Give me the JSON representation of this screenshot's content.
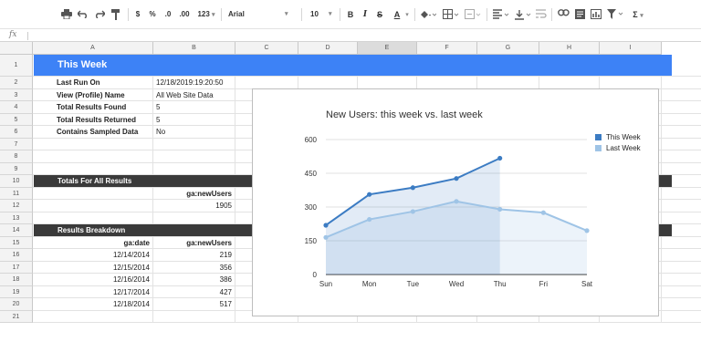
{
  "toolbar": {
    "zoom_label": "123",
    "decimal_decrease": ".0",
    "decimal_increase": ".00",
    "currency": "$",
    "percent": "%",
    "font_name": "Arial",
    "font_size": "10",
    "bold": "B",
    "italic": "I",
    "strike": "S",
    "text_color": "A",
    "functions": "Σ"
  },
  "formula_bar": {
    "fx_label": "fx",
    "value": ""
  },
  "columns": [
    "A",
    "B",
    "C",
    "D",
    "E",
    "F",
    "G",
    "H",
    "I"
  ],
  "selected_column": "E",
  "rows": [
    "1",
    "2",
    "3",
    "4",
    "5",
    "6",
    "7",
    "8",
    "9",
    "10",
    "11",
    "12",
    "13",
    "14",
    "15",
    "16",
    "17",
    "18",
    "19",
    "20",
    "21"
  ],
  "section_title": "This Week",
  "info": [
    {
      "label": "Last Run On",
      "value": "12/18/2019:19:20:50"
    },
    {
      "label": "View (Profile) Name",
      "value": "All Web Site Data"
    },
    {
      "label": "Total Results Found",
      "value": "5"
    },
    {
      "label": "Total Results Returned",
      "value": "5"
    },
    {
      "label": "Contains Sampled Data",
      "value": "No"
    }
  ],
  "totals": {
    "title": "Totals For All Results",
    "header": "ga:newUsers",
    "value": "1905"
  },
  "breakdown": {
    "title": "Results Breakdown",
    "date_header": "ga:date",
    "users_header": "ga:newUsers",
    "rows": [
      {
        "date": "12/14/2014",
        "users": "219"
      },
      {
        "date": "12/15/2014",
        "users": "356"
      },
      {
        "date": "12/16/2014",
        "users": "386"
      },
      {
        "date": "12/17/2014",
        "users": "427"
      },
      {
        "date": "12/18/2014",
        "users": "517"
      }
    ]
  },
  "colors": {
    "header_blue": "#3d82f6",
    "band_dark": "#3a3a3a",
    "this_week": "#3c7cc3",
    "last_week": "#9fc4e6"
  },
  "chart_data": {
    "type": "area",
    "title": "New Users: this week vs. last week",
    "categories": [
      "Sun",
      "Mon",
      "Tue",
      "Wed",
      "Thu",
      "Fri",
      "Sat"
    ],
    "y_ticks": [
      "0",
      "150",
      "300",
      "450",
      "600"
    ],
    "ylim": [
      0,
      600
    ],
    "legend_position": "right",
    "series": [
      {
        "name": "This Week",
        "values": [
          219,
          356,
          386,
          427,
          517,
          null,
          null
        ]
      },
      {
        "name": "Last Week",
        "values": [
          165,
          245,
          280,
          325,
          290,
          275,
          195
        ]
      }
    ]
  }
}
